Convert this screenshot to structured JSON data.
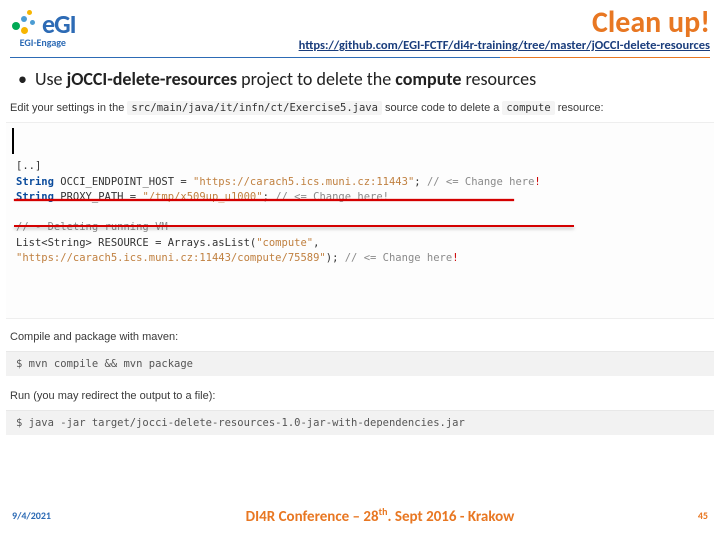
{
  "logo": {
    "initials": "eGI",
    "subtitle": "EGI-Engage"
  },
  "title": "Clean up!",
  "github_url": "https://github.com/EGI-FCTF/di4r-training/tree/master/jOCCI-delete-resources",
  "bullet": {
    "prefix": "Use ",
    "project": "jOCCI-delete-resources",
    "mid": " project to delete the ",
    "strong2": "compute",
    "suffix": " resources"
  },
  "instr1": {
    "pre": "Edit your settings in the ",
    "code": "src/main/java/it/infn/ct/Exercise5.java",
    "mid": " source code to delete a ",
    "code2": "compute",
    "post": " resource:"
  },
  "code_main": {
    "l1": "[..]",
    "l2a": "String",
    "l2b": " OCCI_ENDPOINT_HOST = ",
    "l2c": "\"https://carach5.ics.muni.cz:11443\"",
    "l2d": "; ",
    "l2e": "// <= Change here",
    "l2f": "!",
    "l3a": "String",
    "l3b": " PROXY_PATH = ",
    "l3c": "\"/tmp/x509up_u1000\"",
    "l3d": "; ",
    "l3e": "// <= Change here!",
    "l5": "// - Deleting running VM",
    "l6a": "List<String> RESOURCE = Arrays.asList(",
    "l6b": "\"compute\"",
    "l6c": ",",
    "l7a": "\"https://carach5.ics.muni.cz:11443/compute/75589\"",
    "l7b": "); ",
    "l7c": "// <= Change here",
    "l7d": "!"
  },
  "instr2": "Compile and package with maven:",
  "shell1": "$ mvn compile && mvn package",
  "instr3": "Run (you may redirect the output to a file):",
  "shell2": "$ java -jar target/jocci-delete-resources-1.0-jar-with-dependencies.jar",
  "footer": {
    "date": "9/4/2021",
    "center_pre": "DI4R Conference – 28",
    "center_sup": "th",
    "center_post": ". Sept 2016 - Krakow",
    "page": "45"
  }
}
